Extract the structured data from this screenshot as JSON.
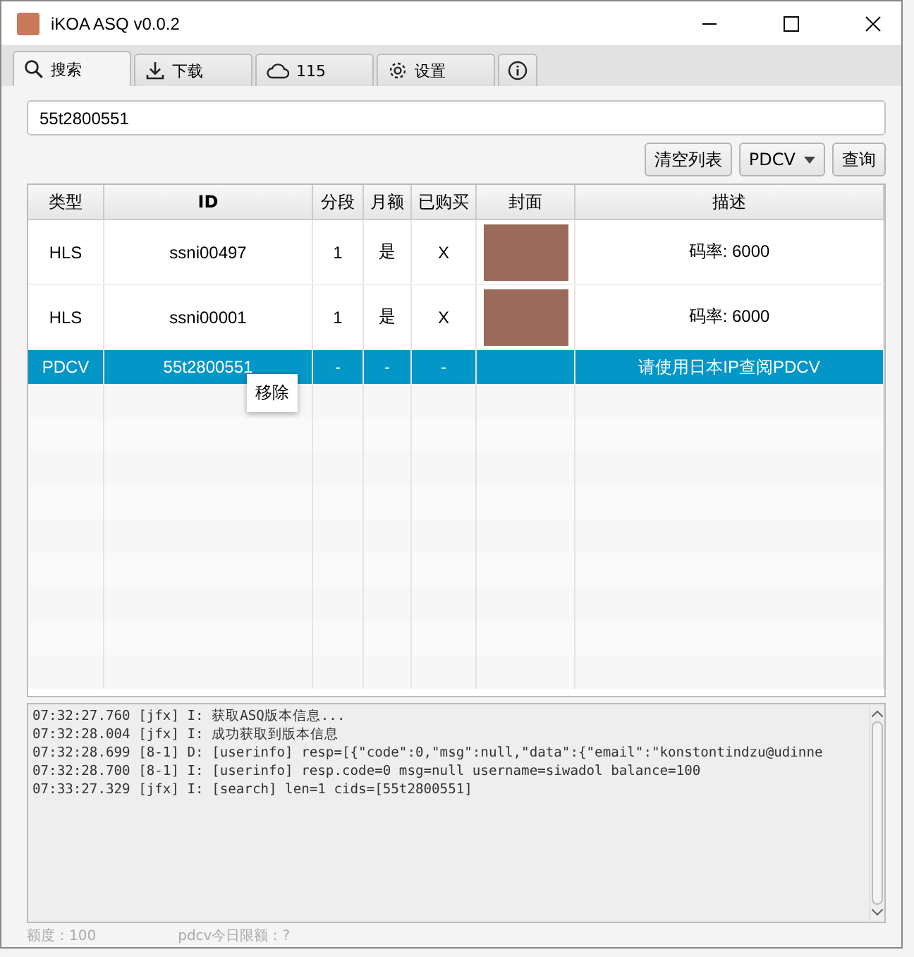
{
  "window": {
    "title": "iKOA ASQ v0.0.2"
  },
  "tabs": [
    {
      "label": "搜索",
      "selected": true
    },
    {
      "label": "下载",
      "selected": false
    },
    {
      "label": "115",
      "selected": false
    },
    {
      "label": "设置",
      "selected": false
    },
    {
      "selected": false
    }
  ],
  "search": {
    "value": "55t2800551"
  },
  "buttons": {
    "clear": "清空列表",
    "mode": "PDCV",
    "query": "查询"
  },
  "table": {
    "columns": [
      "类型",
      "ID",
      "分段",
      "月额",
      "已购买",
      "封面",
      "描述"
    ],
    "rows": [
      {
        "type": "HLS",
        "id": "ssni00497",
        "segments": "1",
        "monthly": "是",
        "purchased": "X",
        "cover": true,
        "description": "码率: 6000",
        "selected": false
      },
      {
        "type": "HLS",
        "id": "ssni00001",
        "segments": "1",
        "monthly": "是",
        "purchased": "X",
        "cover": true,
        "description": "码率: 6000",
        "selected": false
      },
      {
        "type": "PDCV",
        "id": "55t2800551",
        "segments": "-",
        "monthly": "-",
        "purchased": "-",
        "cover": false,
        "description": "请使用日本IP查阅PDCV",
        "selected": true
      }
    ]
  },
  "context_menu": {
    "items": [
      "移除"
    ]
  },
  "log": [
    "07:32:27.760 [jfx] I: 获取ASQ版本信息...",
    "07:32:28.004 [jfx] I: 成功获取到版本信息",
    "07:32:28.699 [8-1] D: [userinfo] resp=[{\"code\":0,\"msg\":null,\"data\":{\"email\":\"konstontindzu@udinne",
    "07:32:28.700 [8-1] I: [userinfo] resp.code=0 msg=null username=siwadol balance=100",
    "07:33:27.329 [jfx] I: [search] len=1 cids=[55t2800551]"
  ],
  "status_bar": {
    "quota": "额度：100",
    "pdcv_limit": "pdcv今日限额：?"
  }
}
